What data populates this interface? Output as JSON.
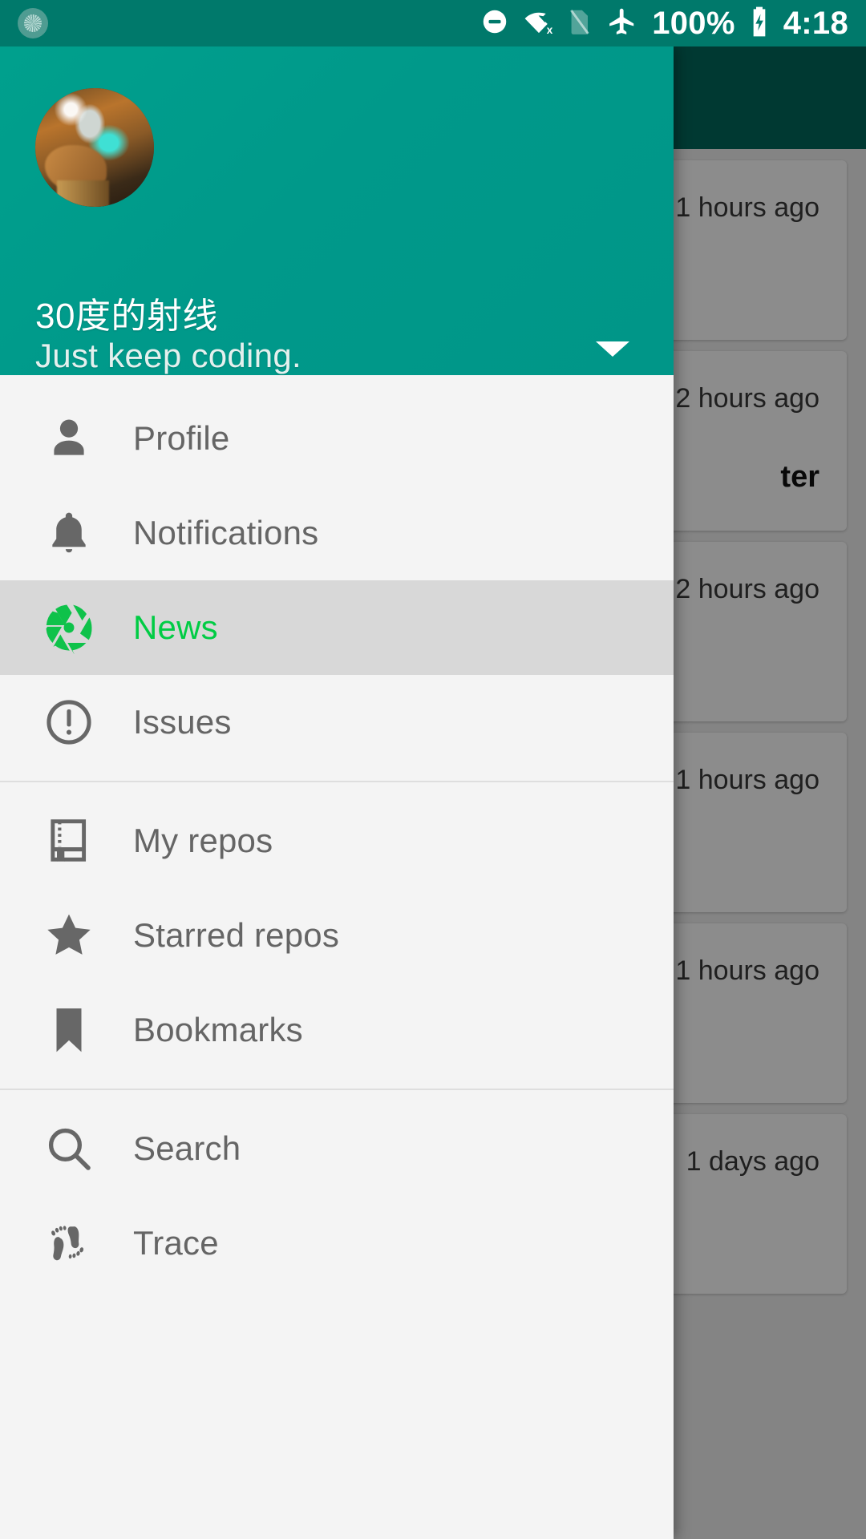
{
  "statusbar": {
    "app_icon": "app-status-icon",
    "icons": [
      {
        "name": "do-not-disturb-icon",
        "label": "Do not disturb"
      },
      {
        "name": "wifi-off-icon",
        "label": "Wi-Fi disconnected"
      },
      {
        "name": "no-sim-icon",
        "label": "No SIM"
      },
      {
        "name": "airplane-mode-icon",
        "label": "Airplane mode"
      }
    ],
    "battery_percent": "100%",
    "battery_icon": "battery-charging-icon",
    "time": "4:18"
  },
  "account": {
    "name": "30度的射线",
    "tagline": "Just keep coding.",
    "avatar_alt": "user-avatar-photo",
    "toggle_icon": "chevron-down-icon"
  },
  "menu": {
    "groups": [
      {
        "items": [
          {
            "icon": "person-icon",
            "label": "Profile",
            "selected": false
          },
          {
            "icon": "bell-icon",
            "label": "Notifications",
            "selected": false
          },
          {
            "icon": "aperture-icon",
            "label": "News",
            "selected": true
          },
          {
            "icon": "exclamation-circle-icon",
            "label": "Issues",
            "selected": false
          }
        ]
      },
      {
        "items": [
          {
            "icon": "repo-book-icon",
            "label": "My repos",
            "selected": false
          },
          {
            "icon": "star-icon",
            "label": "Starred repos",
            "selected": false
          },
          {
            "icon": "bookmark-icon",
            "label": "Bookmarks",
            "selected": false
          }
        ]
      },
      {
        "items": [
          {
            "icon": "search-icon",
            "label": "Search",
            "selected": false
          },
          {
            "icon": "footprints-icon",
            "label": "Trace",
            "selected": false
          }
        ]
      }
    ]
  },
  "background": {
    "cards": [
      {
        "time": "1 hours ago",
        "title": ""
      },
      {
        "time": "2 hours ago",
        "title": "ter"
      },
      {
        "time": "2 hours ago",
        "title": ""
      },
      {
        "time": "1 hours ago",
        "title": ""
      },
      {
        "time": "1 hours ago",
        "title": ""
      },
      {
        "time": "1 days ago",
        "title": ""
      }
    ]
  },
  "colors": {
    "statusbar": "#00796b",
    "drawer_header": "#009688",
    "selected_text": "#00cc44",
    "selected_row": "#d8d8d8",
    "appbar_dim": "#00695c"
  }
}
